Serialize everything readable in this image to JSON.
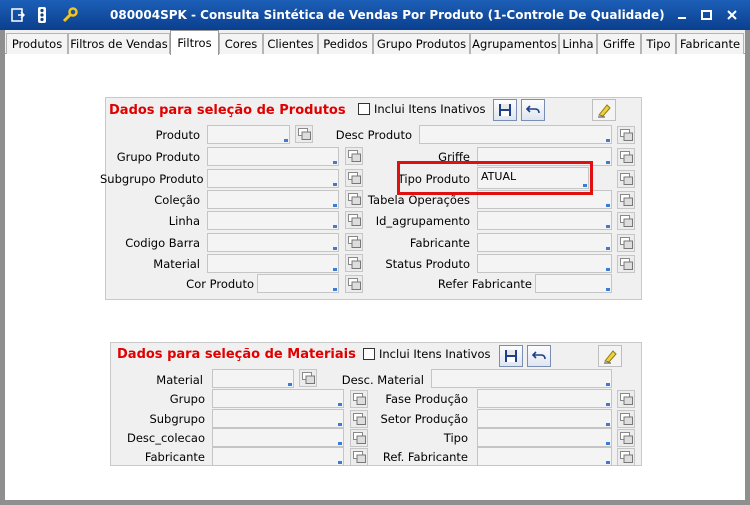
{
  "window": {
    "title": "080004SPK - Consulta Sintética de Vendas Por Produto (1-Controle De Qualidade)",
    "controls": [
      "minimize",
      "maximize",
      "close"
    ]
  },
  "tabs": [
    {
      "label": "Produtos",
      "active": false
    },
    {
      "label": "Filtros de Vendas",
      "active": false
    },
    {
      "label": "Filtros",
      "active": true
    },
    {
      "label": "Cores",
      "active": false
    },
    {
      "label": "Clientes",
      "active": false
    },
    {
      "label": "Pedidos",
      "active": false
    },
    {
      "label": "Grupo Produtos",
      "active": false
    },
    {
      "label": "Agrupamentos",
      "active": false
    },
    {
      "label": "Linha",
      "active": false
    },
    {
      "label": "Griffe",
      "active": false
    },
    {
      "label": "Tipo",
      "active": false
    },
    {
      "label": "Fabricante",
      "active": false
    }
  ],
  "produtos_panel": {
    "title": "Dados para seleção de Produtos",
    "include_inactive_label": "Inclui Itens Inativos",
    "include_inactive_checked": false,
    "left_fields": [
      {
        "label": "Produto",
        "value": ""
      },
      {
        "label": "Grupo Produto",
        "value": ""
      },
      {
        "label": "Subgrupo Produto",
        "value": ""
      },
      {
        "label": "Coleção",
        "value": ""
      },
      {
        "label": "Linha",
        "value": ""
      },
      {
        "label": "Codigo Barra",
        "value": ""
      },
      {
        "label": "Material",
        "value": ""
      },
      {
        "label": "Cor Produto",
        "value": ""
      }
    ],
    "right_fields": [
      {
        "label": "Desc Produto",
        "value": ""
      },
      {
        "label": "Griffe",
        "value": ""
      },
      {
        "label": "Tipo Produto",
        "value": "ATUAL"
      },
      {
        "label": "Tabela Operações",
        "value": ""
      },
      {
        "label": "Id_agrupamento",
        "value": ""
      },
      {
        "label": "Fabricante",
        "value": ""
      },
      {
        "label": "Status Produto",
        "value": ""
      },
      {
        "label": "Refer Fabricante",
        "value": ""
      }
    ]
  },
  "materiais_panel": {
    "title": "Dados para seleção de Materiais",
    "include_inactive_label": "Inclui Itens Inativos",
    "include_inactive_checked": false,
    "left_fields": [
      {
        "label": "Material",
        "value": ""
      },
      {
        "label": "Grupo",
        "value": ""
      },
      {
        "label": "Subgrupo",
        "value": ""
      },
      {
        "label": "Desc_colecao",
        "value": ""
      },
      {
        "label": "Fabricante",
        "value": ""
      }
    ],
    "right_fields": [
      {
        "label": "Desc. Material",
        "value": ""
      },
      {
        "label": "Fase Produção",
        "value": ""
      },
      {
        "label": "Setor Produção",
        "value": ""
      },
      {
        "label": "Tipo",
        "value": ""
      },
      {
        "label": "Ref. Fabricante",
        "value": ""
      }
    ]
  },
  "colors": {
    "titlebar": "#0b3f8e",
    "panel_title": "#e00000",
    "highlight": "#e01010"
  }
}
